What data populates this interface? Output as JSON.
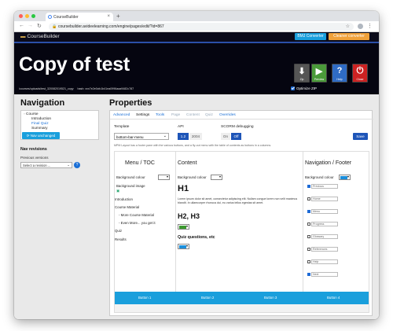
{
  "browser": {
    "tab_title": "CourseBuilder",
    "url": "coursebuilder.avideelearning.com/engine/pages/edit/?id=867",
    "colors": {
      "close": "#ff5f57",
      "minimize": "#febc2e",
      "maximize": "#28c840"
    }
  },
  "header": {
    "brand": "CourseBuilder",
    "bmj_button": "BMJ Converter",
    "cleaner_button": "Cleaner converter",
    "page_title": "Copy of test",
    "path": "/courses/uploads/test_320082019521_copy",
    "meta": "hash: xxx7e2e0cfc1b41ea0996aaa9482c787",
    "buttons": [
      {
        "icon": "zip-icon",
        "label": "Zip",
        "color": "#555555"
      },
      {
        "icon": "play-icon",
        "label": "Preview",
        "color": "#4a9a3a"
      },
      {
        "icon": "help-icon",
        "label": "Help",
        "color": "#2f6bc4"
      },
      {
        "icon": "close-icon",
        "label": "Close",
        "color": "#cc2222"
      }
    ],
    "optimize_label": "Optimize ZIP"
  },
  "navigation": {
    "heading": "Navigation",
    "tree": [
      "Course",
      "Introduction",
      "Final Quiz",
      "Summary"
    ],
    "button": "Nav unchanged",
    "revisions_heading": "Nav revisions",
    "previous_label": "Previous versions",
    "revision_select": "Select a revision ..."
  },
  "properties": {
    "heading": "Properties",
    "tabs": [
      "Advanced",
      "Settings",
      "Tools",
      "Page",
      "Content",
      "Quiz",
      "Overrides"
    ],
    "template_label": "Template",
    "template_value": "bottom-bar-menu",
    "api_label": "API",
    "api_options": [
      "1.2",
      "2004"
    ],
    "scorm_label": "SCORM debugging",
    "scorm_options": [
      "On",
      "Off"
    ],
    "save_button": "Save",
    "note": "MPM Layout has a footer pane with the various buttons, and a fly-out menu with the table of contents as buttons in a columns.",
    "menu_col": {
      "heading": "Menu / TOC",
      "bg_colour": "Background colour",
      "bg_image": "Background image",
      "items": [
        "Introduction",
        "Course Material",
        "- More Course Material",
        "- Even More... you get it",
        "Quiz",
        "Results"
      ]
    },
    "content_col": {
      "heading": "Content",
      "bg_colour": "Background colour",
      "h1": "H1",
      "lorem": "Lorem ipsum dolor sit amet, consectetur adipiscing elit. Nullam congue lorem non velit maximus blandit. In ullamcorper rhoncus dui, eu varius tellus egestas sit amet.",
      "h23": "H2, H3",
      "quiz": "Quiz questions, etc",
      "swatch_green": "#3c9a2e",
      "swatch_blue": "#1a8fdc"
    },
    "footer_col": {
      "heading": "Navigation / Footer",
      "bg_colour": "Background colour",
      "items": [
        {
          "label": "Previous",
          "checked": true
        },
        {
          "label": "Home",
          "checked": false
        },
        {
          "label": "Menu",
          "checked": true
        },
        {
          "label": "Progress",
          "checked": false
        },
        {
          "label": "Glossary",
          "checked": false
        },
        {
          "label": "References",
          "checked": false
        },
        {
          "label": "Help",
          "checked": false
        },
        {
          "label": "Next",
          "checked": true
        }
      ]
    },
    "footer_buttons": [
      "Button 1",
      "Button 2",
      "Button 3",
      "Button 4"
    ]
  }
}
